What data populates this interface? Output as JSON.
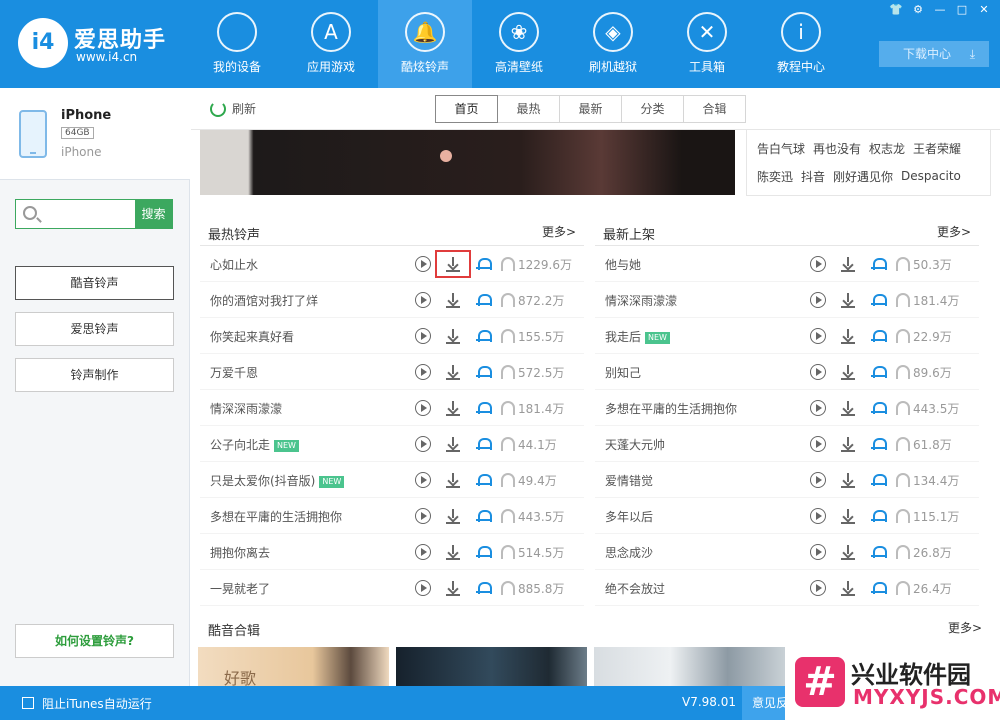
{
  "app": {
    "brand": "爱思助手",
    "url": "www.i4.cn",
    "logo_text": "i4"
  },
  "nav": [
    {
      "label": "我的设备",
      "icon": "apple-icon",
      "glyph": ""
    },
    {
      "label": "应用游戏",
      "icon": "appstore-icon",
      "glyph": "A"
    },
    {
      "label": "酷炫铃声",
      "icon": "bell-icon",
      "glyph": "🔔",
      "active": true
    },
    {
      "label": "高清壁纸",
      "icon": "flower-icon",
      "glyph": "❀"
    },
    {
      "label": "刷机越狱",
      "icon": "dropbox-icon",
      "glyph": "◈"
    },
    {
      "label": "工具箱",
      "icon": "tools-icon",
      "glyph": "✕"
    },
    {
      "label": "教程中心",
      "icon": "info-icon",
      "glyph": "i"
    }
  ],
  "window_controls": [
    "👕",
    "⚙",
    "—",
    "□",
    "✕"
  ],
  "download_center": {
    "label": "下载中心",
    "icon": "download-icon"
  },
  "device": {
    "name": "iPhone",
    "capacity": "64GB",
    "model": "iPhone"
  },
  "search": {
    "placeholder": "",
    "button_label": "搜索"
  },
  "sidebar": {
    "items": [
      {
        "label": "酷音铃声",
        "active": true
      },
      {
        "label": "爱思铃声"
      },
      {
        "label": "铃声制作"
      }
    ],
    "howto": "如何设置铃声?"
  },
  "toolbar": {
    "refresh_label": "刷新",
    "tabs": [
      {
        "label": "首页",
        "active": true
      },
      {
        "label": "最热"
      },
      {
        "label": "最新"
      },
      {
        "label": "分类"
      },
      {
        "label": "合辑"
      }
    ]
  },
  "tags": {
    "row1": [
      "告白气球",
      "再也没有",
      "权志龙",
      "王者荣耀"
    ],
    "row2": [
      "陈奕迅",
      "抖音",
      "刚好遇见你",
      "Despacito"
    ]
  },
  "hot_ringtones": {
    "title": "最热铃声",
    "more": "更多>",
    "items": [
      {
        "name": "心如止水",
        "plays": "1229.6万",
        "is_new": false
      },
      {
        "name": "你的酒馆对我打了烊",
        "plays": "872.2万",
        "is_new": false
      },
      {
        "name": "你笑起来真好看",
        "plays": "155.5万",
        "is_new": false
      },
      {
        "name": "万爱千恩",
        "plays": "572.5万",
        "is_new": false
      },
      {
        "name": "情深深雨濛濛",
        "plays": "181.4万",
        "is_new": false
      },
      {
        "name": "公子向北走",
        "plays": "44.1万",
        "is_new": true
      },
      {
        "name": "只是太爱你(抖音版)",
        "plays": "49.4万",
        "is_new": true
      },
      {
        "name": "多想在平庸的生活拥抱你",
        "plays": "443.5万",
        "is_new": false
      },
      {
        "name": "拥抱你离去",
        "plays": "514.5万",
        "is_new": false
      },
      {
        "name": "一晃就老了",
        "plays": "885.8万",
        "is_new": false
      }
    ]
  },
  "new_ringtones": {
    "title": "最新上架",
    "more": "更多>",
    "items": [
      {
        "name": "他与她",
        "plays": "50.3万",
        "is_new": false
      },
      {
        "name": "情深深雨濛濛",
        "plays": "181.4万",
        "is_new": false
      },
      {
        "name": "我走后",
        "plays": "22.9万",
        "is_new": true
      },
      {
        "name": "别知己",
        "plays": "89.6万",
        "is_new": false
      },
      {
        "name": "多想在平庸的生活拥抱你",
        "plays": "443.5万",
        "is_new": false
      },
      {
        "name": "天蓬大元帅",
        "plays": "61.8万",
        "is_new": false
      },
      {
        "name": "爱情错觉",
        "plays": "134.4万",
        "is_new": false
      },
      {
        "name": "多年以后",
        "plays": "115.1万",
        "is_new": false
      },
      {
        "name": "思念成沙",
        "plays": "26.8万",
        "is_new": false
      },
      {
        "name": "绝不会放过",
        "plays": "26.4万",
        "is_new": false
      }
    ]
  },
  "new_badge": "NEW",
  "albums": {
    "title": "酷音合辑",
    "more": "更多>",
    "album1_text": "好歌"
  },
  "status": {
    "block_itunes": "阻止iTunes自动运行",
    "version": "V7.98.01",
    "feedback": "意见反"
  },
  "watermark": {
    "mark": "#",
    "name": "兴业软件园",
    "url": "MYXYJS.COM"
  },
  "colors": {
    "brand_blue": "#1a8ee0",
    "accent_green": "#3ca85f",
    "highlight_red": "#e03c3c",
    "new_badge": "#4bc48e"
  }
}
